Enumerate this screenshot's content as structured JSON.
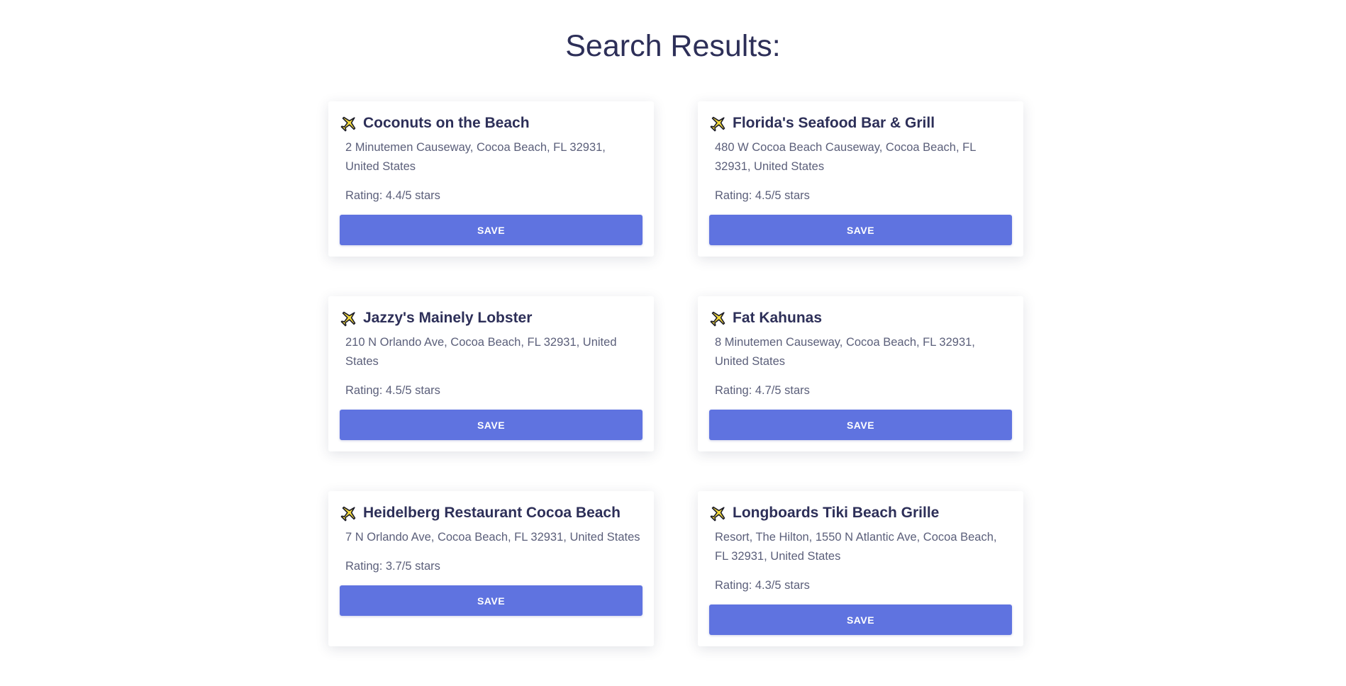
{
  "page": {
    "title": "Search Results:"
  },
  "colors": {
    "accent": "#5f73e0",
    "title_text": "#2d2f58",
    "body_text": "#5b5f7a"
  },
  "results": [
    {
      "icon": "airplane-icon",
      "name": "Coconuts on the Beach",
      "address": "2 Minutemen Causeway, Cocoa Beach, FL 32931, United States",
      "rating": "Rating: 4.4/5 stars",
      "save_label": "SAVE"
    },
    {
      "icon": "airplane-icon",
      "name": "Florida's Seafood Bar & Grill",
      "address": "480 W Cocoa Beach Causeway, Cocoa Beach, FL 32931, United States",
      "rating": "Rating: 4.5/5 stars",
      "save_label": "SAVE"
    },
    {
      "icon": "airplane-icon",
      "name": "Jazzy's Mainely Lobster",
      "address": "210 N Orlando Ave, Cocoa Beach, FL 32931, United States",
      "rating": "Rating: 4.5/5 stars",
      "save_label": "SAVE"
    },
    {
      "icon": "airplane-icon",
      "name": "Fat Kahunas",
      "address": "8 Minutemen Causeway, Cocoa Beach, FL 32931, United States",
      "rating": "Rating: 4.7/5 stars",
      "save_label": "SAVE"
    },
    {
      "icon": "airplane-icon",
      "name": "Heidelberg Restaurant Cocoa Beach",
      "address": "7 N Orlando Ave, Cocoa Beach, FL 32931, United States",
      "rating": "Rating: 3.7/5 stars",
      "save_label": "SAVE"
    },
    {
      "icon": "airplane-icon",
      "name": "Longboards Tiki Beach Grille",
      "address": "Resort, The Hilton, 1550 N Atlantic Ave, Cocoa Beach, FL 32931, United States",
      "rating": "Rating: 4.3/5 stars",
      "save_label": "SAVE"
    }
  ]
}
